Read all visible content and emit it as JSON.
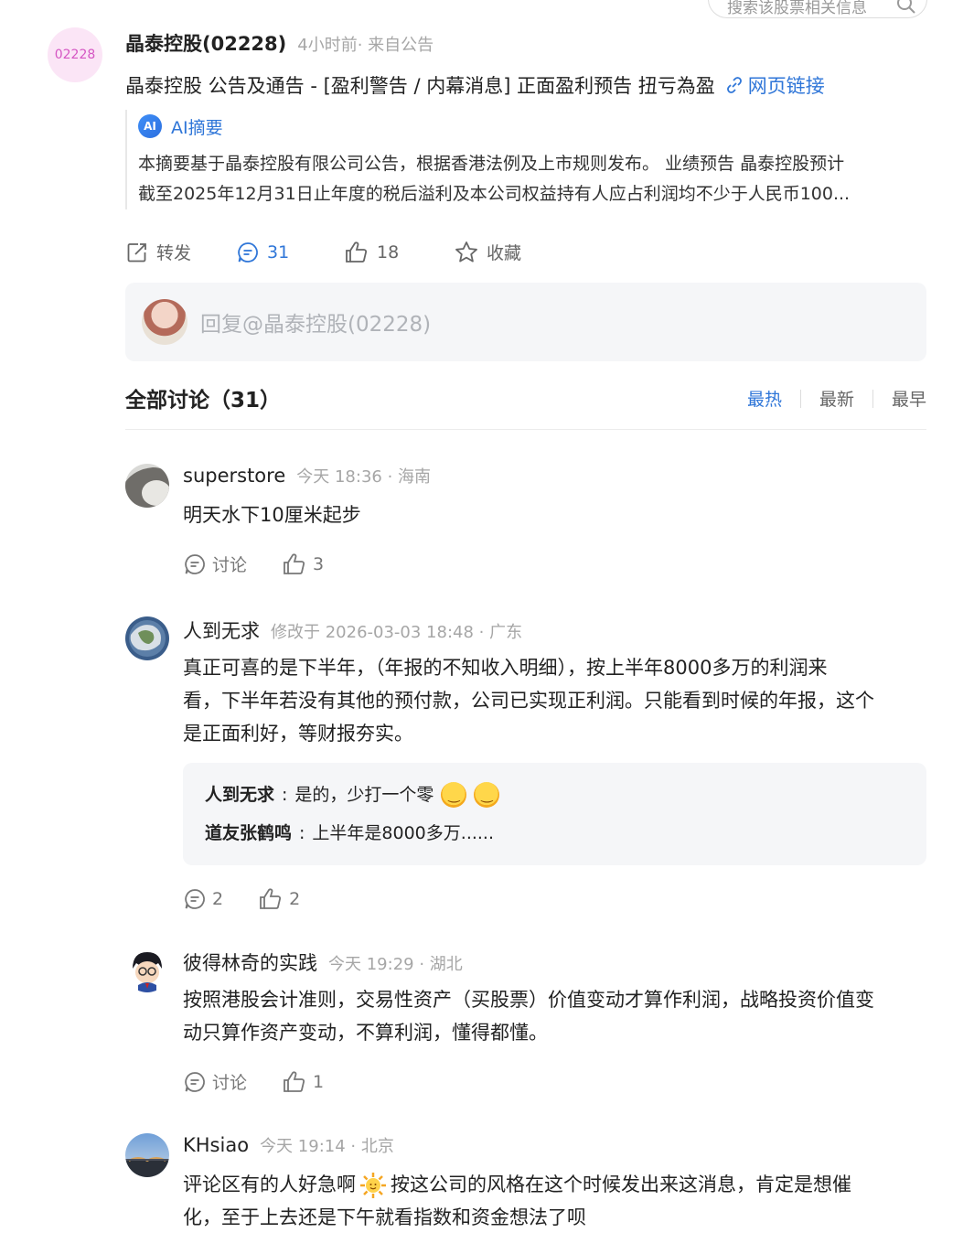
{
  "search": {
    "placeholder": "搜索该股票相关信息"
  },
  "post": {
    "stock_code_avatar": "02228",
    "author": "晶泰控股(02228)",
    "meta": "4小时前· 来自公告",
    "title": "晶泰控股 公告及通告 - [盈利警告 / 内幕消息] 正面盈利预告 扭亏為盈",
    "link_label": "网页链接",
    "ai_summary": {
      "badge": "AI",
      "label": "AI摘要",
      "line1": "本摘要基于晶泰控股有限公司公告，根据香港法例及上市规则发布。 业绩预告 晶泰控股预计",
      "line2": "截至2025年12月31日止年度的税后溢利及本公司权益持有人应占利润均不少于人民币100..."
    },
    "actions": {
      "forward": "转发",
      "comments": "31",
      "likes": "18",
      "favorite": "收藏"
    }
  },
  "reply_box": {
    "placeholder": "回复@晶泰控股(02228)"
  },
  "discussion": {
    "title": "全部讨论（31）",
    "sort": [
      "最热",
      "最新",
      "最早"
    ],
    "active_sort": "最热"
  },
  "comments": [
    {
      "name": "superstore",
      "meta": "今天 18:36 · 海南",
      "lines": [
        "明天水下10厘米起步"
      ],
      "reply_label": "讨论",
      "likes": "3"
    },
    {
      "name": "人到无求",
      "meta": "修改于 2026-03-03 18:48 · 广东",
      "lines": [
        "真正可喜的是下半年，（年报的不知收入明细），按上半年8000多万的利润来",
        "看，下半年若没有其他的预付款，公司已实现正利润。只能看到时候的年报，这个",
        "是正面利好，等财报夯实。"
      ],
      "sub_replies": [
        {
          "name": "人到无求",
          "text": "是的，少打一个零"
        },
        {
          "name": "道友张鹤鸣",
          "text": "上半年是8000多万......"
        }
      ],
      "reply_label": "2",
      "likes": "2"
    },
    {
      "name": "彼得林奇的实践",
      "meta": "今天 19:29 · 湖北",
      "lines": [
        "按照港股会计准则，交易性资产（买股票）价值变动才算作利润，战略投资价值变",
        "动只算作资产变动，不算利润，懂得都懂。"
      ],
      "reply_label": "讨论",
      "likes": "1"
    },
    {
      "name": "KHsiao",
      "meta": "今天 19:14 · 北京",
      "line1_a": "评论区有的人好急啊",
      "line1_b": "按这公司的风格在这个时候发出来这消息，肯定是想催",
      "line2": "化，至于上去还是下午就看指数和资金想法了呗"
    }
  ],
  "colors": {
    "accent": "#2f76d8",
    "meta_gray": "#a6a6a6",
    "avatar_pink": "#fbe5f6"
  }
}
